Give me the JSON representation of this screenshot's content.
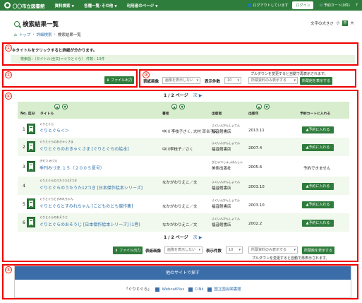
{
  "nav": {
    "logo": "〇〇市立図書館",
    "items": [
      "資料検索",
      "各種一覧･その他",
      "利用者のページ"
    ],
    "logout_text": "ログアウトしています",
    "login": "ログイン",
    "cart": "予約カート(0件)",
    "help": "?"
  },
  "page": {
    "title": "検索結果一覧",
    "fontsize_label": "文字の大きさ",
    "fontsize": [
      "小",
      "中",
      "大"
    ]
  },
  "breadcrumb": [
    "トップ",
    "詳細検索",
    "検索結果一覧"
  ],
  "markers": [
    "①",
    "②",
    "③",
    "④",
    "⑤"
  ],
  "section1": {
    "hint": "※タイトルをクリックすると詳細が分かります。",
    "condition": "検索語：（タイトル(全文)＝ぐりとぐら）  件数：13件"
  },
  "controls": {
    "file_output": "ファイル出力",
    "note": "プルダウンを変更すると自動で再表示されます。",
    "cover_label": "表紙画像",
    "cover_value": "画像を表示しない",
    "count_label": "表示件数",
    "count_value": "10",
    "holding_value": "所蔵資料のみ表示する",
    "holding_button": "所蔵館を表示する"
  },
  "pager": {
    "text": "1 / 2 ページ",
    "next": "次"
  },
  "table": {
    "headers": {
      "no": "No.",
      "type": "区分",
      "title": "タイトル",
      "author": "著者",
      "publisher": "出版者",
      "year": "出版年",
      "reserve": "予約カートに入れる"
    },
    "reserve_button": "予約に入れる",
    "unavailable": "予約できません",
    "rows": [
      {
        "no": "1",
        "kana": "ぐりとぐら",
        "title": "ぐりとぐら＜＞",
        "author": "中川 李枝子さく, 大村 百合子え",
        "pub_kana": "ふくいんかんしょてん",
        "publisher": "福音館書店",
        "year": "2013.11",
        "reserve": true
      },
      {
        "no": "2",
        "kana": "ぐりとぐらのおきゃくさま",
        "title": "ぐりとぐらのおきゃくさま [ぐりとぐらの絵本]",
        "author": "中川李枝子／さく",
        "pub_kana": "ふくいんかんしょてん",
        "publisher": "福音館書店",
        "year": "2007.4",
        "reserve": true
      },
      {
        "no": "3",
        "kana": "きせつ みづえ",
        "title": "季刊みづゑ １５（２００５夏号）",
        "author": "",
        "pub_kana": "びじゅつしゅっぱんしゃ",
        "publisher": "美術出版社",
        "year": "2005.6",
        "reserve": false
      },
      {
        "no": "4",
        "kana": "ぐりとぐらのうたうた12つき",
        "title": "ぐりとぐらのうたうた12つき [日本傑作絵本シリーズ]",
        "author": "なかがわりえこ／文",
        "pub_kana": "ふくいんかんしょてん",
        "publisher": "福音館書店",
        "year": "2003.10",
        "reserve": true
      },
      {
        "no": "5",
        "kana": "ぐりとぐらとすみれちゃん",
        "title": "ぐりとぐらとすみれちゃん [こどものとも傑作集]",
        "author": "なかがわりえこ／文",
        "pub_kana": "ふくいんかんしょてん",
        "publisher": "福音館書店",
        "year": "2003.10",
        "reserve": true
      },
      {
        "no": "6",
        "kana": "ぐりとぐらのおそうじ",
        "title": "ぐりとぐらのおそうじ [日本傑作絵本シリーズ] (1巻)",
        "author": "なかがわりえこ／文",
        "pub_kana": "ふくいんかんしょてん",
        "publisher": "福音館書店",
        "year": "2002.2",
        "reserve": true
      }
    ]
  },
  "other_sites": {
    "title": "他のサイトで探す",
    "keyword": "「ぐりとぐら」",
    "links": [
      "WebcatPlus",
      "CiNii",
      "国立国会図書館"
    ]
  }
}
